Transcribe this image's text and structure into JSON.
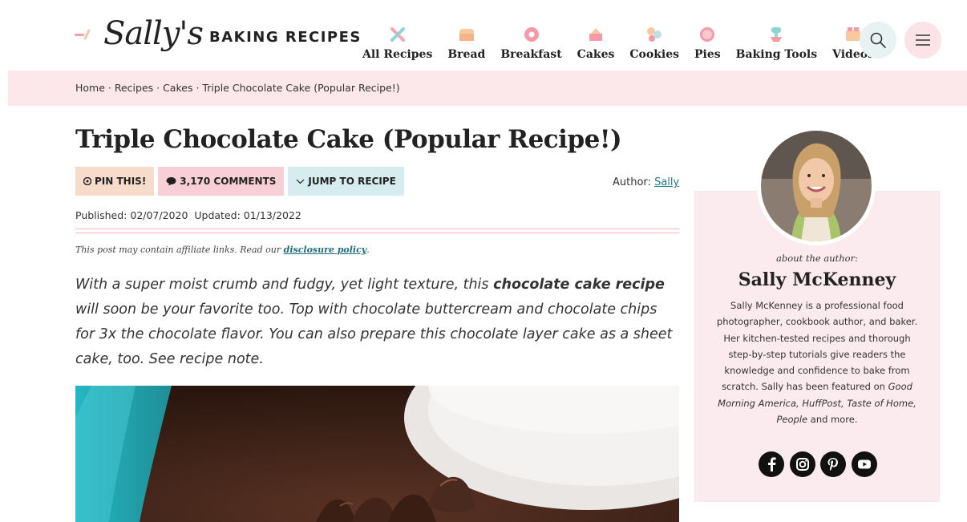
{
  "site": {
    "logo_script": "Sally's",
    "logo_text": "BAKING RECIPES"
  },
  "nav": {
    "items": [
      {
        "label": "All Recipes",
        "icon": "whisk-spoon-icon"
      },
      {
        "label": "Bread",
        "icon": "bread-loaf-icon"
      },
      {
        "label": "Breakfast",
        "icon": "donut-icon"
      },
      {
        "label": "Cakes",
        "icon": "cake-icon"
      },
      {
        "label": "Cookies",
        "icon": "cookies-icon"
      },
      {
        "label": "Pies",
        "icon": "pie-icon"
      },
      {
        "label": "Baking Tools",
        "icon": "stand-mixer-icon"
      },
      {
        "label": "Videos",
        "icon": "video-icon"
      }
    ],
    "search_icon": "search-icon",
    "menu_icon": "hamburger-menu-icon"
  },
  "breadcrumb": {
    "items": [
      "Home",
      "Recipes",
      "Cakes",
      "Triple Chocolate Cake (Popular Recipe!)"
    ],
    "separator": " · "
  },
  "post": {
    "title": "Triple Chocolate Cake (Popular Recipe!)",
    "pin_label": "PIN THIS!",
    "comments_label": "3,170 COMMENTS",
    "jump_label": "JUMP TO RECIPE",
    "author_prefix": "Author:",
    "author_name": "Sally",
    "published": "Published: 02/07/2020",
    "updated": "Updated: 01/13/2022",
    "affiliate_text": "This post may contain affiliate links. Read our",
    "affiliate_link": "disclosure policy",
    "affiliate_end": ".",
    "intro_1": "With a super moist crumb and fudgy, yet light texture, this",
    "intro_bold": "chocolate cake recipe",
    "intro_2": "will soon be your favorite too. Top with chocolate buttercream and chocolate chips for 3x the chocolate flavor. You can also prepare this chocolate layer cake as a sheet cake, too. See recipe note."
  },
  "sidebar": {
    "about_label": "about the author:",
    "name": "Sally McKenney",
    "bio_1": "Sally McKenney is a professional food photographer, cookbook author, and baker. Her kitchen-tested recipes and thorough step-by-step tutorials give readers the knowledge and confidence to bake from scratch. Sally has been featured on",
    "bio_pubs": "Good Morning America, HuffPost, Taste of Home, People",
    "bio_end": "and more.",
    "socials": [
      "facebook-icon",
      "instagram-icon",
      "pinterest-icon",
      "youtube-icon"
    ]
  },
  "colors": {
    "pink_bar": "#fce7ea",
    "link_teal": "#1f7a8c",
    "pin_bg": "#f8dccb",
    "comments_bg": "#f8cfd6",
    "jump_bg": "#d7ecee"
  }
}
